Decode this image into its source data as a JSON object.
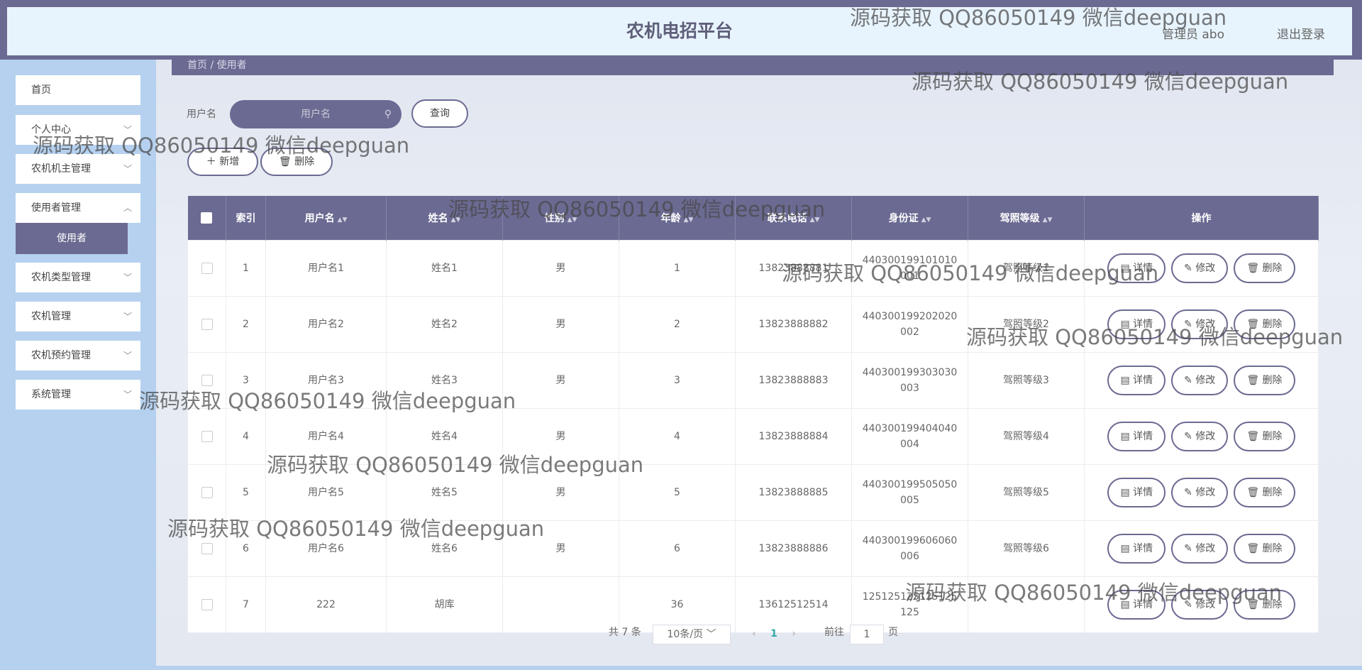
{
  "header": {
    "title": "农机电招平台",
    "user": "管理员 abo",
    "logout": "退出登录"
  },
  "sidebar": {
    "items": [
      {
        "label": "首页"
      },
      {
        "label": "个人中心"
      },
      {
        "label": "农机机主管理"
      },
      {
        "label": "使用者管理"
      },
      {
        "label": "农机类型管理"
      },
      {
        "label": "农机管理"
      },
      {
        "label": "农机预约管理"
      },
      {
        "label": "系统管理"
      }
    ],
    "sub_active": "使用者"
  },
  "breadcrumb": "首页 / 使用者",
  "search": {
    "label": "用户名",
    "placeholder": "用户名",
    "button": "查询"
  },
  "toolbar": {
    "add": "新增",
    "delete": "删除"
  },
  "table": {
    "headers": [
      "索引",
      "用户名",
      "姓名",
      "性别",
      "年龄",
      "联系电话",
      "身份证",
      "驾照等级",
      "操作"
    ],
    "rows": [
      [
        "1",
        "用户名1",
        "姓名1",
        "男",
        "1",
        "13823888881",
        "440300199101010001",
        "驾照等级1"
      ],
      [
        "2",
        "用户名2",
        "姓名2",
        "男",
        "2",
        "13823888882",
        "440300199202020002",
        "驾照等级2"
      ],
      [
        "3",
        "用户名3",
        "姓名3",
        "男",
        "3",
        "13823888883",
        "440300199303030003",
        "驾照等级3"
      ],
      [
        "4",
        "用户名4",
        "姓名4",
        "男",
        "4",
        "13823888884",
        "440300199404040004",
        "驾照等级4"
      ],
      [
        "5",
        "用户名5",
        "姓名5",
        "男",
        "5",
        "13823888885",
        "440300199505050005",
        "驾照等级5"
      ],
      [
        "6",
        "用户名6",
        "姓名6",
        "男",
        "6",
        "13823888886",
        "440300199606060006",
        "驾照等级6"
      ],
      [
        "7",
        "222",
        "胡库",
        "",
        "36",
        "13612512514",
        "125125125125125125",
        ""
      ]
    ],
    "actions": {
      "detail": "详情",
      "edit": "修改",
      "delete": "删除"
    }
  },
  "pagination": {
    "total": "共 7 条",
    "page_size": "10条/页",
    "current": "1",
    "goto_prefix": "前往",
    "goto_value": "1",
    "goto_suffix": "页"
  },
  "watermark": "源码获取 QQ86050149 微信deepguan",
  "colors": {
    "primary": "#6b6a92",
    "sidebar": "#b5d1ef",
    "header": "#e8f4fd"
  }
}
